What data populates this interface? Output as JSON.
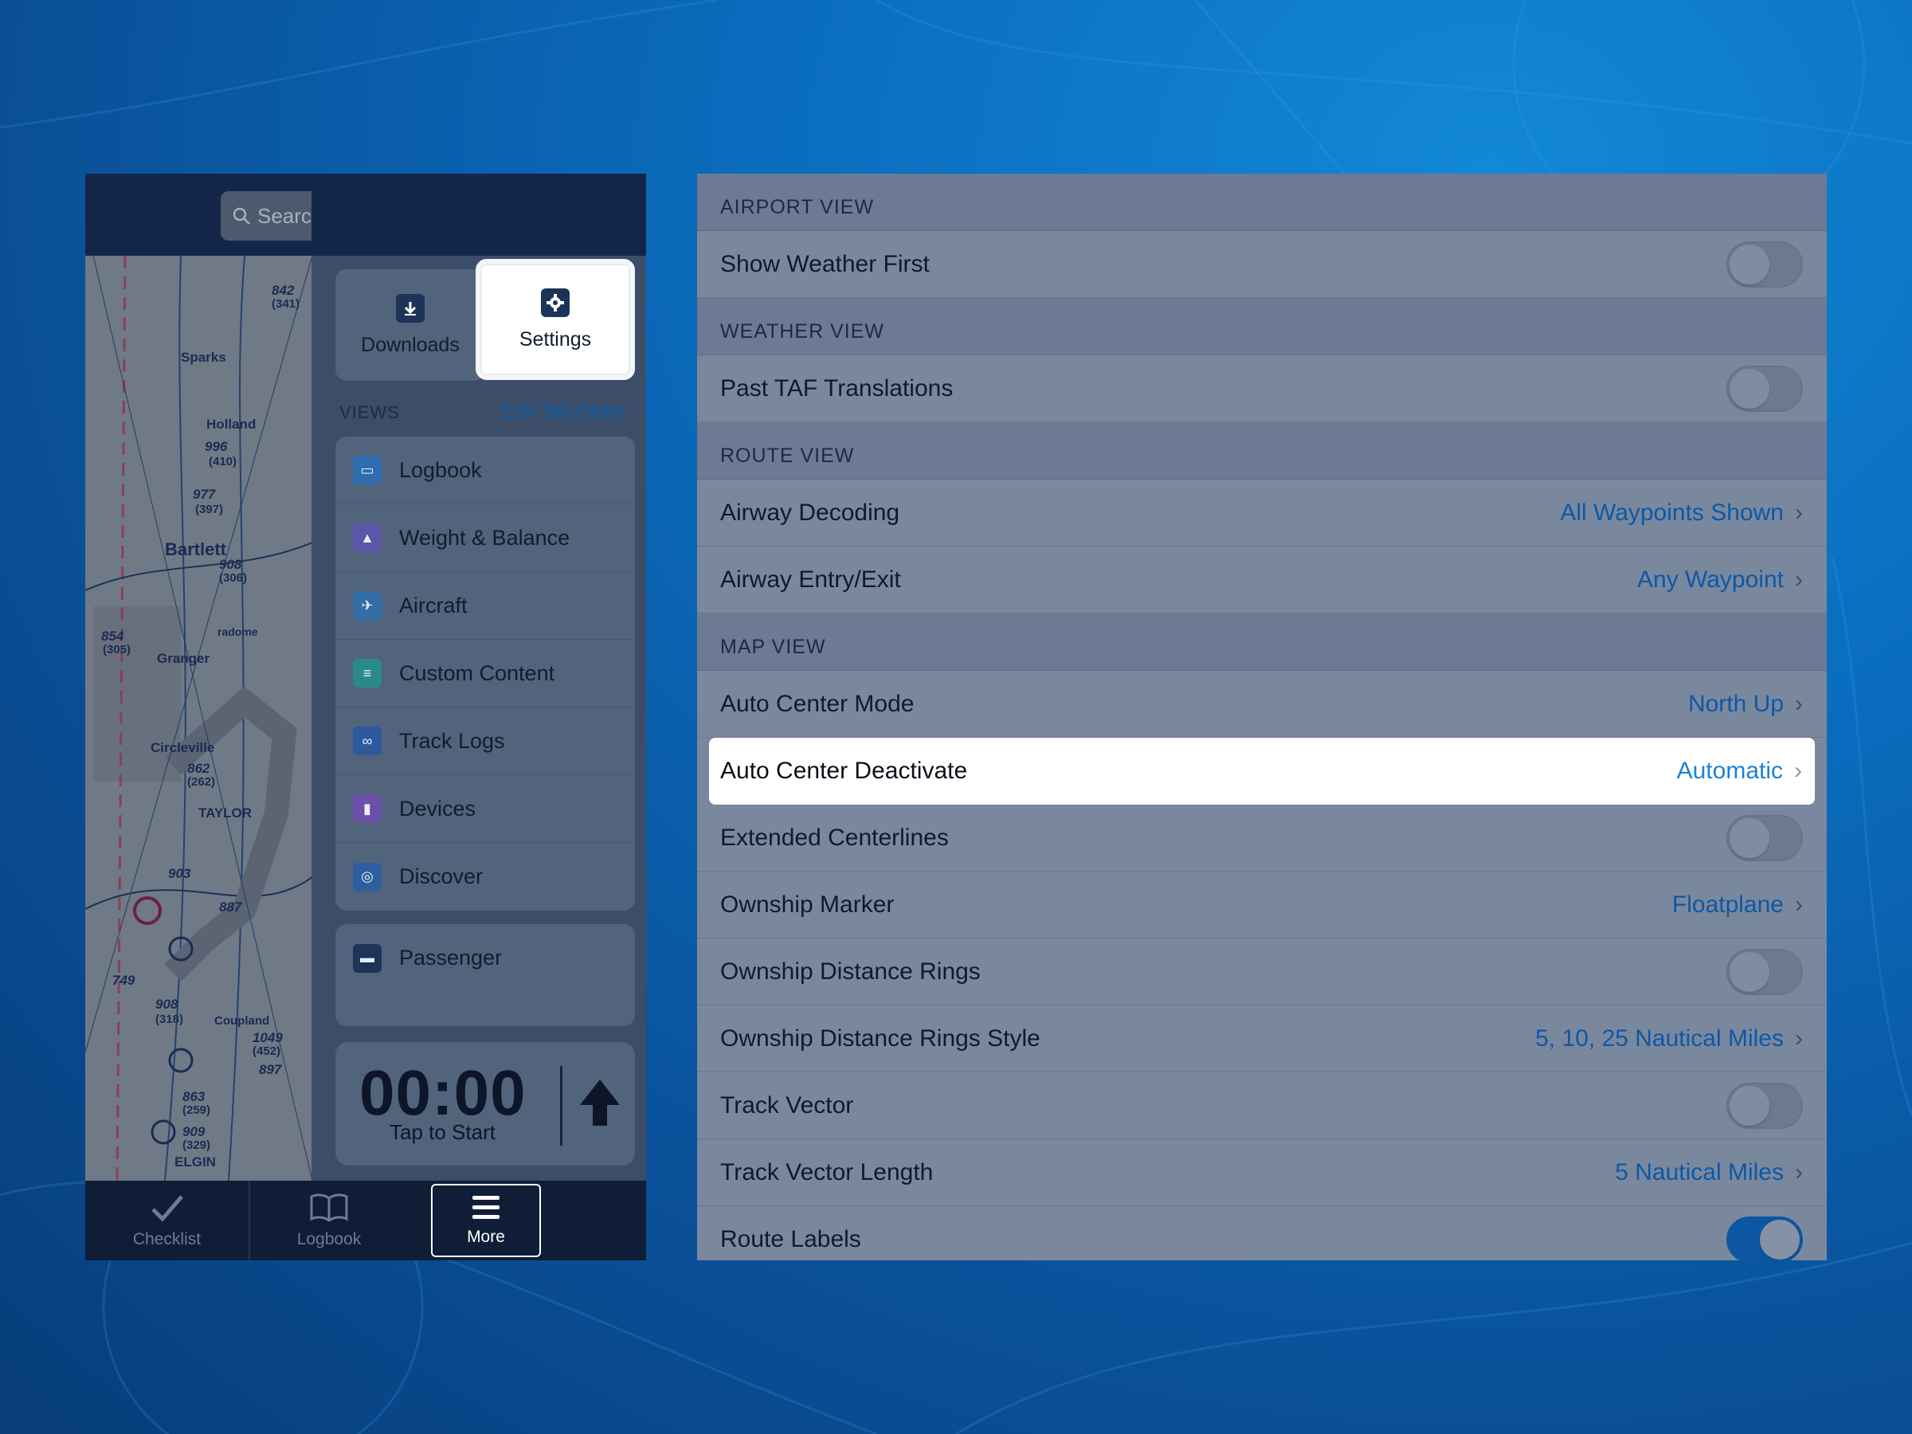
{
  "colors": {
    "background": "#0a6cbd",
    "panel_dim": "#7a889e",
    "accent_blue": "#0d58a6",
    "highlight": "#ffffff"
  },
  "left": {
    "search": {
      "placeholder": "Searc",
      "icon": "search-icon"
    },
    "tiles": [
      {
        "label": "Downloads",
        "icon": "download-icon"
      },
      {
        "label": "Settings",
        "icon": "gear-icon"
      }
    ],
    "views_label": "VIEWS",
    "edit_tab_order": "Edit Tab Order",
    "menu": [
      {
        "label": "Logbook",
        "icon": "book-icon",
        "color": "#2d6db0"
      },
      {
        "label": "Weight & Balance",
        "icon": "weight-icon",
        "color": "#5a57a8"
      },
      {
        "label": "Aircraft",
        "icon": "plane-icon",
        "color": "#336ea6"
      },
      {
        "label": "Custom Content",
        "icon": "document-icon",
        "color": "#2a8a8a"
      },
      {
        "label": "Track Logs",
        "icon": "tracklog-icon",
        "color": "#2d5a9e"
      },
      {
        "label": "Devices",
        "icon": "plug-icon",
        "color": "#6b4fa8"
      },
      {
        "label": "Discover",
        "icon": "binoculars-icon",
        "color": "#2d5f9e"
      }
    ],
    "menu2": [
      {
        "label": "Passenger",
        "icon": "passenger-icon",
        "color": "#1c3458"
      }
    ],
    "timer": {
      "time": "00:00",
      "subtitle": "Tap to Start"
    },
    "tabbar": [
      {
        "label": "Checklist",
        "icon": "checkmark-icon"
      },
      {
        "label": "Logbook",
        "icon": "book-open-icon"
      },
      {
        "label": "More",
        "icon": "hamburger-icon"
      }
    ],
    "map_labels": [
      "Sparks",
      "Holland",
      "Bartlett",
      "Granger",
      "Circleville",
      "TAYLOR",
      "ELGIN",
      "radome",
      "996",
      "(410)",
      "977",
      "(397)",
      "908",
      "(306)",
      "854",
      "(305)",
      "862",
      "(262)",
      "903",
      "887",
      "749",
      "908",
      "(318)",
      "Coupland",
      "1049",
      "(452)",
      "897",
      "863",
      "(259)",
      "909",
      "(329)",
      "842",
      "(341)"
    ]
  },
  "settings": {
    "sections": [
      {
        "header": "AIRPORT VIEW",
        "rows": [
          {
            "label": "Show Weather First",
            "toggle": "off"
          }
        ]
      },
      {
        "header": "WEATHER VIEW",
        "rows": [
          {
            "label": "Past TAF Translations",
            "toggle": "off"
          }
        ]
      },
      {
        "header": "ROUTE VIEW",
        "rows": [
          {
            "label": "Airway Decoding",
            "value": "All Waypoints Shown"
          },
          {
            "label": "Airway Entry/Exit",
            "value": "Any Waypoint"
          }
        ]
      },
      {
        "header": "MAP VIEW",
        "rows": [
          {
            "label": "Auto Center Mode",
            "value": "North Up"
          },
          {
            "label": "Auto Center Deactivate",
            "value": "Automatic",
            "highlight": true
          },
          {
            "label": "Extended Centerlines",
            "toggle": "off"
          },
          {
            "label": "Ownship Marker",
            "value": "Floatplane"
          },
          {
            "label": "Ownship Distance Rings",
            "toggle": "off"
          },
          {
            "label": "Ownship Distance Rings Style",
            "value": "5, 10, 25 Nautical Miles"
          },
          {
            "label": "Track Vector",
            "toggle": "off"
          },
          {
            "label": "Track Vector Length",
            "value": "5 Nautical Miles"
          },
          {
            "label": "Route Labels",
            "toggle": "on"
          }
        ]
      }
    ]
  }
}
